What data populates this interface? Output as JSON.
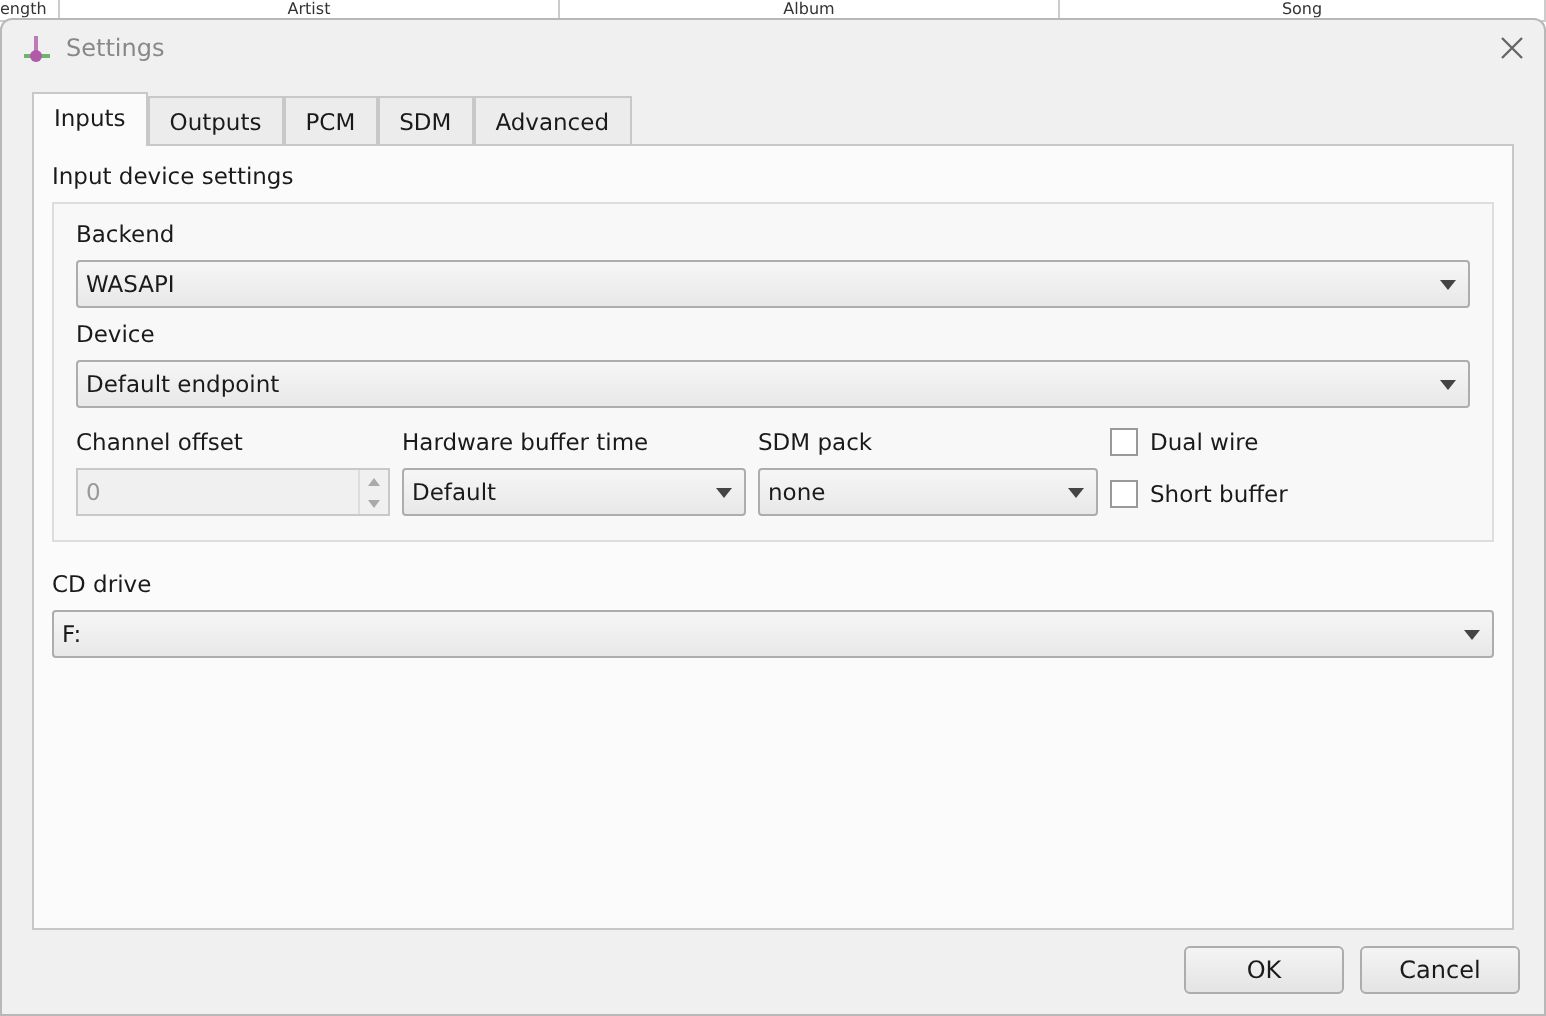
{
  "background_table": {
    "columns": [
      "ength",
      "Artist",
      "Album",
      "Song"
    ]
  },
  "window": {
    "title": "Settings"
  },
  "tabs": [
    {
      "label": "Inputs",
      "selected": true
    },
    {
      "label": "Outputs",
      "selected": false
    },
    {
      "label": "PCM",
      "selected": false
    },
    {
      "label": "SDM",
      "selected": false
    },
    {
      "label": "Advanced",
      "selected": false
    }
  ],
  "input_group": {
    "title": "Input device settings",
    "backend": {
      "label": "Backend",
      "value": "WASAPI"
    },
    "device": {
      "label": "Device",
      "value": "Default endpoint"
    },
    "channel_offset": {
      "label": "Channel offset",
      "value": "0",
      "disabled": true
    },
    "buffer_time": {
      "label": "Hardware buffer time",
      "value": "Default"
    },
    "sdm_pack": {
      "label": "SDM pack",
      "value": "none"
    },
    "checkboxes": [
      {
        "label": "Dual wire",
        "checked": false
      },
      {
        "label": "Short buffer",
        "checked": false
      }
    ]
  },
  "cd_drive": {
    "label": "CD drive",
    "value": "F:"
  },
  "buttons": [
    "OK",
    "Cancel"
  ]
}
